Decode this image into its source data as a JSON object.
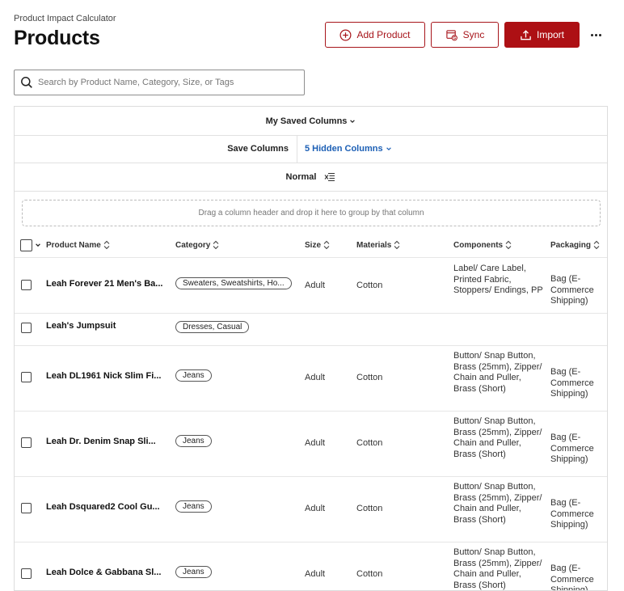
{
  "header": {
    "app_label": "Product Impact Calculator",
    "title": "Products",
    "add_product_label": "Add Product",
    "sync_label": "Sync",
    "import_label": "Import"
  },
  "search": {
    "placeholder": "Search by Product Name, Category, Size, or Tags",
    "value": ""
  },
  "toolbar": {
    "saved_columns_label": "My Saved Columns",
    "save_columns_label": "Save Columns",
    "hidden_columns_label": "5 Hidden Columns",
    "density_label": "Normal"
  },
  "group_dropzone_text": "Drag a column header and drop it here to group by that column",
  "columns": [
    "Product Name",
    "Category",
    "Size",
    "Materials",
    "Components",
    "Packaging"
  ],
  "rows": [
    {
      "name": "Leah Forever 21 Men's Ba...",
      "category": "Sweaters, Sweatshirts, Ho...",
      "size": "Adult",
      "materials": "Cotton",
      "components": "Label/ Care Label, Printed Fabric, Stoppers/ Endings, PP",
      "packaging": "Bag (E-Commerce Shipping)"
    },
    {
      "name": "Leah's Jumpsuit",
      "category": "Dresses, Casual",
      "size": "",
      "materials": "",
      "components": "",
      "packaging": ""
    },
    {
      "name": "Leah DL1961 Nick Slim Fi...",
      "category": "Jeans",
      "size": "Adult",
      "materials": "Cotton",
      "components": "Button/ Snap Button, Brass (25mm), Zipper/ Chain and Puller, Brass (Short)",
      "packaging": "Bag (E-Commerce Shipping)"
    },
    {
      "name": "Leah Dr. Denim Snap Sli...",
      "category": "Jeans",
      "size": "Adult",
      "materials": "Cotton",
      "components": "Button/ Snap Button, Brass (25mm), Zipper/ Chain and Puller, Brass (Short)",
      "packaging": "Bag (E-Commerce Shipping)"
    },
    {
      "name": "Leah Dsquared2 Cool Gu...",
      "category": "Jeans",
      "size": "Adult",
      "materials": "Cotton",
      "components": "Button/ Snap Button, Brass (25mm), Zipper/ Chain and Puller, Brass (Short)",
      "packaging": "Bag (E-Commerce Shipping)"
    },
    {
      "name": "Leah Dolce & Gabbana Sl...",
      "category": "Jeans",
      "size": "Adult",
      "materials": "Cotton",
      "components": "Button/ Snap Button, Brass (25mm), Zipper/ Chain and Puller, Brass (Short)",
      "packaging": "Bag (E-Commerce Shipping)"
    }
  ],
  "colors": {
    "brand": "#ad1014",
    "link": "#1c5fb5"
  }
}
